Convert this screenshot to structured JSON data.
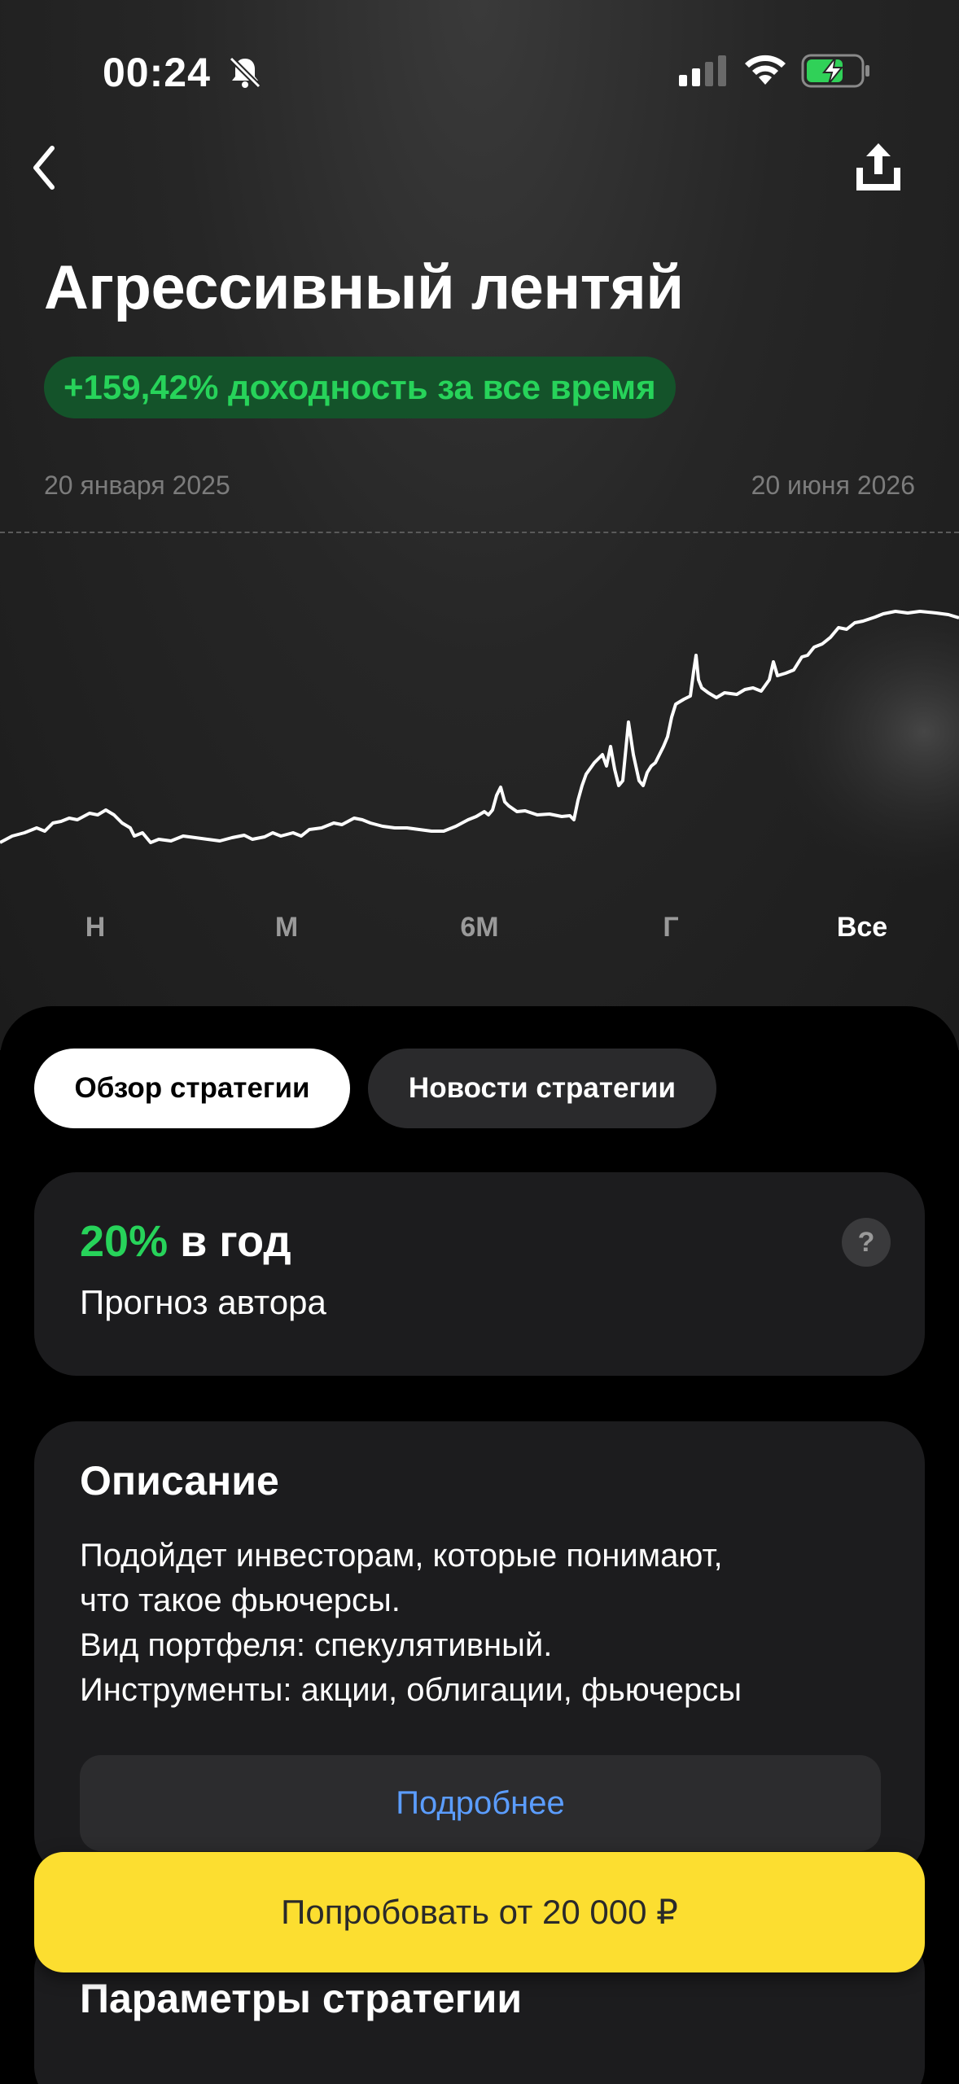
{
  "status_bar": {
    "time": "00:24",
    "icons": [
      "bell-slash-icon",
      "signal-icon",
      "wifi-icon",
      "battery-charging-icon"
    ]
  },
  "nav": {
    "back_icon": "chevron-left-icon",
    "share_icon": "share-icon"
  },
  "strategy": {
    "title": "Агрессивный лентяй",
    "yield_label": "+159,42% доходность за все время",
    "date_start": "20 января 2025",
    "date_end": "20 июня 2026"
  },
  "periods": [
    {
      "label": "Н",
      "active": false
    },
    {
      "label": "М",
      "active": false
    },
    {
      "label": "6М",
      "active": false
    },
    {
      "label": "Г",
      "active": false
    },
    {
      "label": "Все",
      "active": true
    }
  ],
  "tabs": {
    "overview": "Обзор стратегии",
    "news": "Новости стратегии"
  },
  "forecast": {
    "percent": "20%",
    "suffix": "в год",
    "subtitle": "Прогноз автора",
    "help_label": "?"
  },
  "description": {
    "title": "Описание",
    "lines": [
      "Подойдет инвесторам, которые понимают,",
      "что такое фьючерсы.",
      "Вид портфеля: спекулятивный.",
      "Инструменты: акции, облигации, фьючерсы"
    ],
    "more_label": "Подробнее"
  },
  "parameters": {
    "title": "Параметры стратегии"
  },
  "cta": {
    "label": "Попробовать от 20 000 ₽"
  },
  "colors": {
    "accent_green": "#27d35a",
    "cta_yellow": "#fcde30",
    "link_blue": "#5b9dff"
  }
}
